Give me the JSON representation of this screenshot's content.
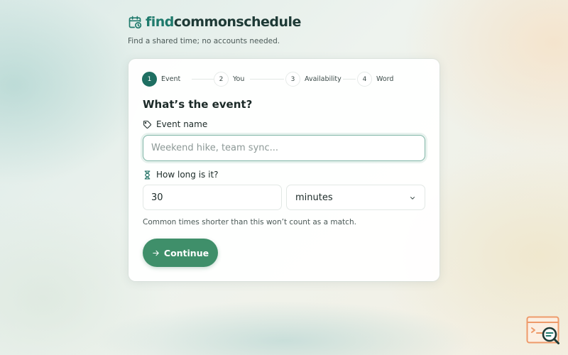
{
  "brand": {
    "name_accent": "find",
    "name_rest": "commonschedule",
    "tagline": "Find a shared time; no accounts needed.",
    "icon": "calendar-clock-icon"
  },
  "stepper": {
    "steps": [
      {
        "number": "1",
        "label": "Event",
        "active": true
      },
      {
        "number": "2",
        "label": "You",
        "active": false
      },
      {
        "number": "3",
        "label": "Availability",
        "active": false
      },
      {
        "number": "4",
        "label": "Word",
        "active": false
      }
    ]
  },
  "form": {
    "title": "What’s the event?",
    "event_name": {
      "label": "Event name",
      "icon": "tag-icon",
      "value": "",
      "placeholder": "Weekend hike, team sync..."
    },
    "duration": {
      "label": "How long is it?",
      "icon": "hourglass-icon",
      "value": "30",
      "unit": "minutes",
      "unit_options": [
        "minutes"
      ]
    },
    "hint": "Common times shorter than this won’t count as a match.",
    "continue_label": "Continue",
    "continue_icon": "arrow-right-icon"
  },
  "colors": {
    "brand_accent": "#1f7a6c",
    "active_step": "#1f6f62",
    "primary_button": "#3f8f6a",
    "focus_border": "#7fb5a6"
  }
}
